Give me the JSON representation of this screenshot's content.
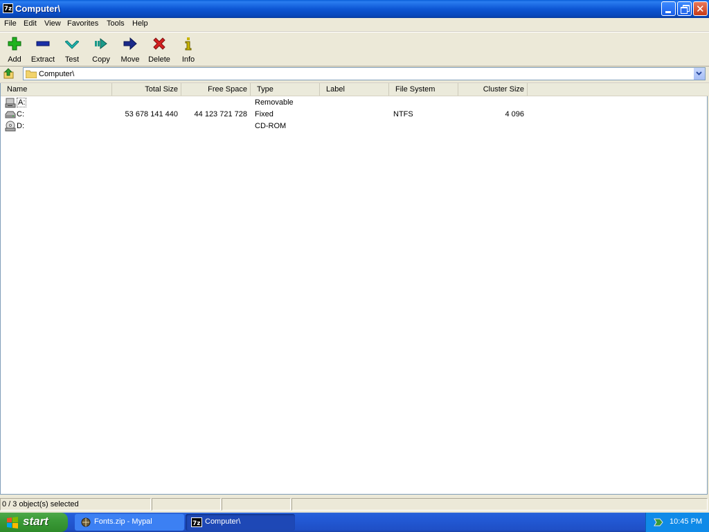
{
  "window": {
    "title": "Computer\\",
    "app_icon_text": "7z"
  },
  "menu": [
    "File",
    "Edit",
    "View",
    "Favorites",
    "Tools",
    "Help"
  ],
  "toolbar": [
    {
      "label": "Add",
      "icon": "plus-icon",
      "color": "#1fb31f"
    },
    {
      "label": "Extract",
      "icon": "minus-icon",
      "color": "#1a2fa8"
    },
    {
      "label": "Test",
      "icon": "check-icon",
      "color": "#20b8b0"
    },
    {
      "label": "Copy",
      "icon": "copy-arrow-icon",
      "color": "#1a9a8a"
    },
    {
      "label": "Move",
      "icon": "move-arrow-icon",
      "color": "#1a2a8a"
    },
    {
      "label": "Delete",
      "icon": "delete-x-icon",
      "color": "#d42020"
    },
    {
      "label": "Info",
      "icon": "info-icon",
      "color": "#c8b400"
    }
  ],
  "address": {
    "value": "Computer\\"
  },
  "columns": [
    "Name",
    "Total Size",
    "Free Space",
    "Type",
    "Label",
    "File System",
    "Cluster Size"
  ],
  "rows": [
    {
      "name": "A:",
      "total": "",
      "free": "",
      "type": "Removable",
      "label": "",
      "fs": "",
      "cluster": "",
      "icon": "floppy-drive-icon"
    },
    {
      "name": "C:",
      "total": "53 678 141 440",
      "free": "44 123 721 728",
      "type": "Fixed",
      "label": "",
      "fs": "NTFS",
      "cluster": "4 096",
      "icon": "hard-drive-icon"
    },
    {
      "name": "D:",
      "total": "",
      "free": "",
      "type": "CD-ROM",
      "label": "",
      "fs": "",
      "cluster": "",
      "icon": "cdrom-drive-icon"
    }
  ],
  "status": {
    "selection": "0 / 3 object(s) selected"
  },
  "taskbar": {
    "start_label": "start",
    "tasks": [
      {
        "label": "Fonts.zip - Mypal"
      },
      {
        "label": "Computer\\"
      }
    ],
    "clock": "10:45 PM"
  }
}
